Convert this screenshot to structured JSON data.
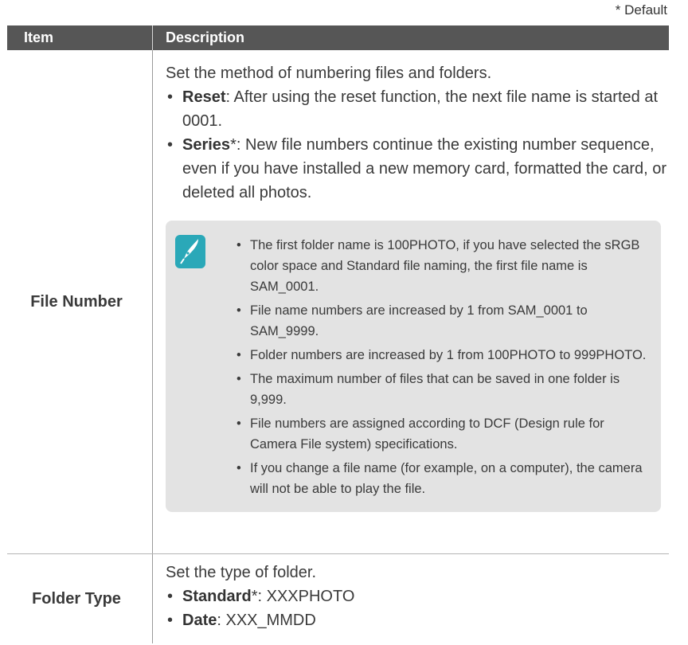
{
  "default_note": "* Default",
  "header": {
    "item": "Item",
    "description": "Description"
  },
  "rows": [
    {
      "item": "File Number",
      "intro": "Set the method of numbering files and folders.",
      "options": [
        {
          "name": "Reset",
          "mark": "",
          "text": ": After using the reset function, the next file name is started at 0001."
        },
        {
          "name": "Series",
          "mark": "*",
          "text": ": New file numbers continue the existing number sequence, even if you have installed a new memory card, formatted the card, or deleted all photos."
        }
      ],
      "note": {
        "icon": "pen-nib-icon",
        "items": [
          "The first folder name is 100PHOTO, if you have selected the sRGB color space and Standard file naming, the first file name is SAM_0001.",
          "File name numbers are increased by 1 from SAM_0001 to SAM_9999.",
          "Folder numbers are increased by 1 from 100PHOTO to 999PHOTO.",
          "The maximum number of files that can be saved in one folder is 9,999.",
          "File numbers are assigned according to DCF (Design rule for Camera File system) specifications.",
          "If you change a file name (for example, on a computer), the camera will not be able to play the file."
        ]
      }
    },
    {
      "item": "Folder Type",
      "intro": "Set the type of folder.",
      "options": [
        {
          "name": "Standard",
          "mark": "*",
          "text": ": XXXPHOTO"
        },
        {
          "name": "Date",
          "mark": "",
          "text": ": XXX_MMDD"
        }
      ]
    }
  ],
  "colors": {
    "header_bg": "#565656",
    "note_bg": "#e3e3e3",
    "icon": "#2aa8b8"
  }
}
